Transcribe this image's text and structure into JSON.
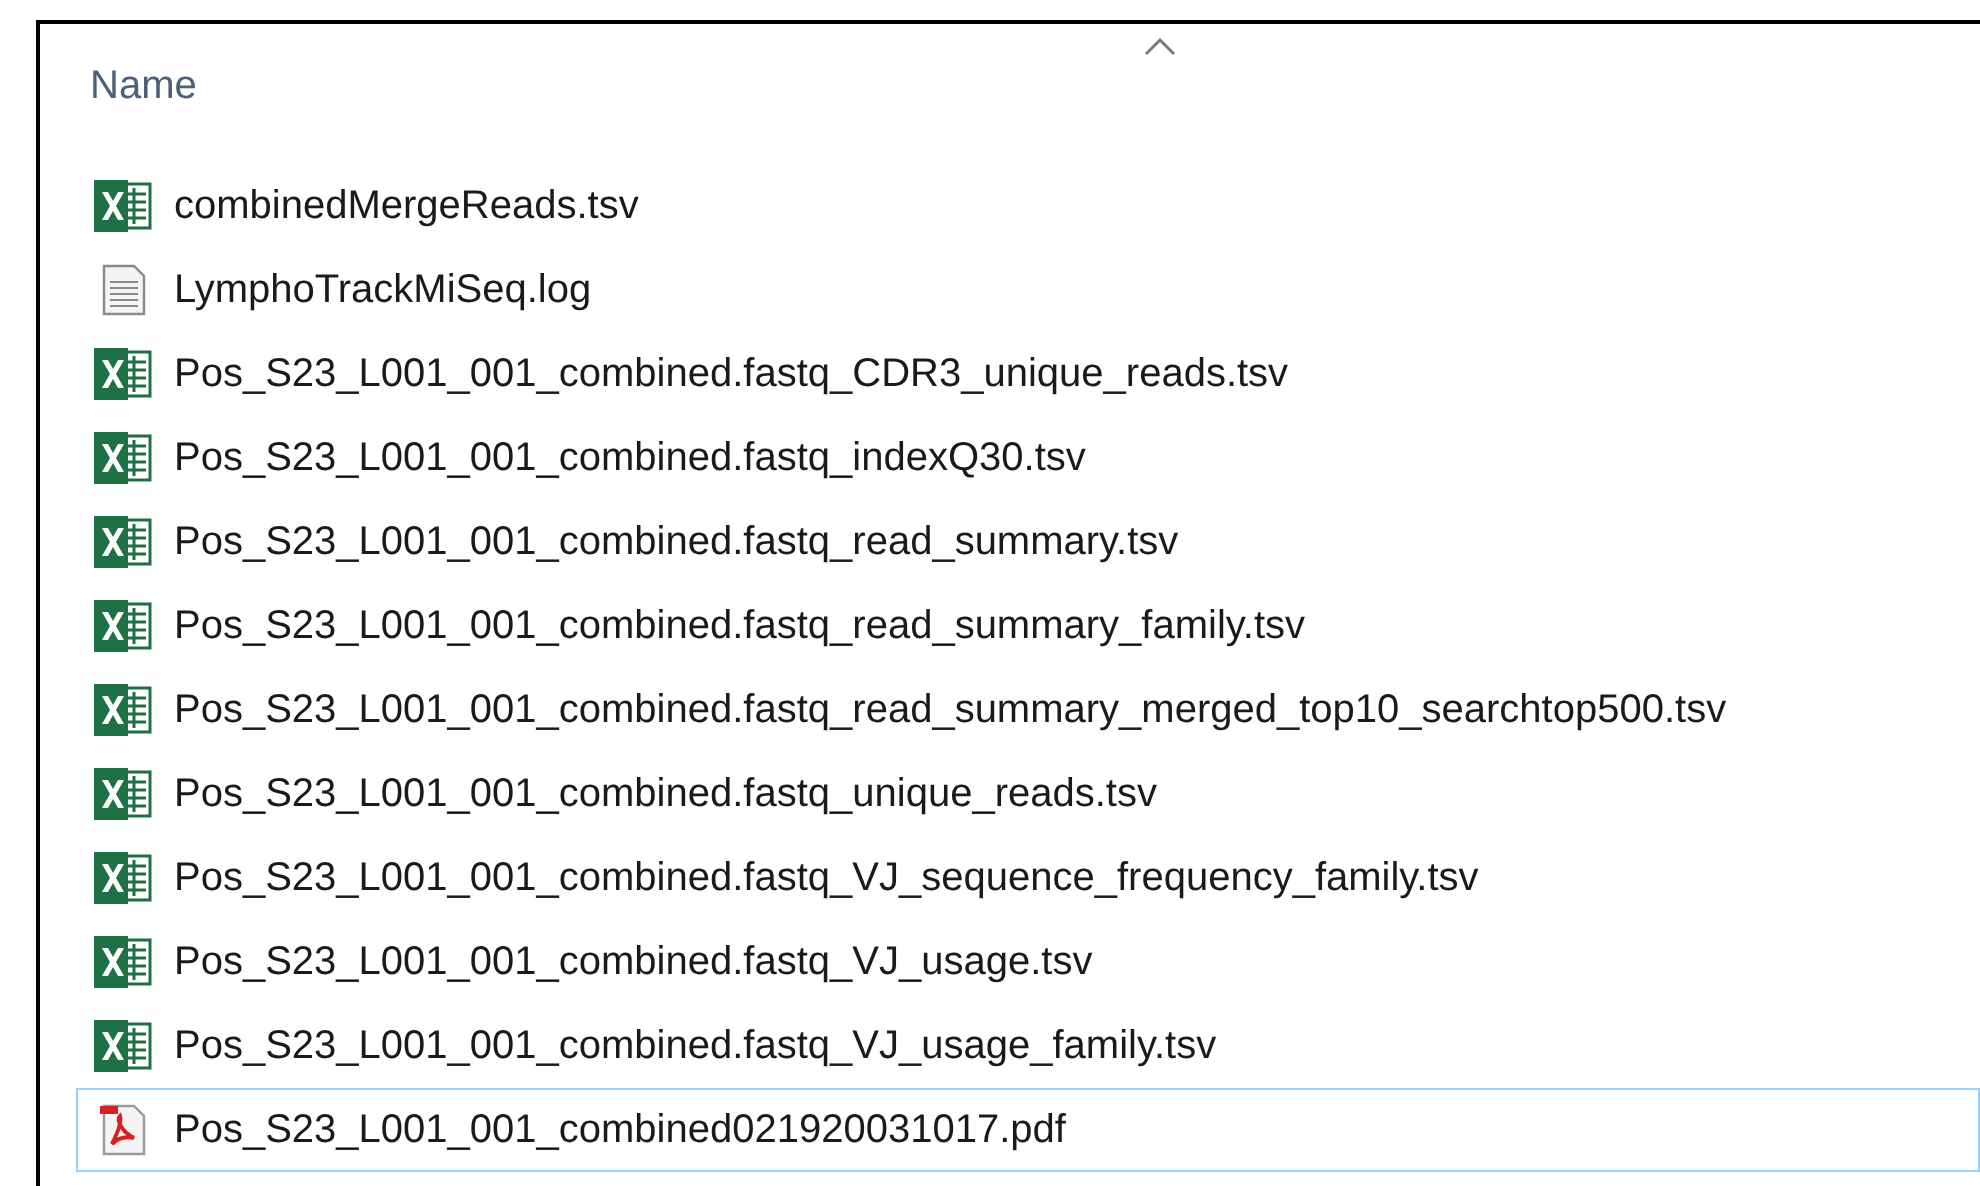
{
  "column_header": {
    "label": "Name",
    "sort_ascending": true
  },
  "files": [
    {
      "name": "combinedMergeReads.tsv",
      "kind": "excel",
      "focused": false
    },
    {
      "name": "LymphoTrackMiSeq.log",
      "kind": "text",
      "focused": false
    },
    {
      "name": "Pos_S23_L001_001_combined.fastq_CDR3_unique_reads.tsv",
      "kind": "excel",
      "focused": false
    },
    {
      "name": "Pos_S23_L001_001_combined.fastq_indexQ30.tsv",
      "kind": "excel",
      "focused": false
    },
    {
      "name": "Pos_S23_L001_001_combined.fastq_read_summary.tsv",
      "kind": "excel",
      "focused": false
    },
    {
      "name": "Pos_S23_L001_001_combined.fastq_read_summary_family.tsv",
      "kind": "excel",
      "focused": false
    },
    {
      "name": "Pos_S23_L001_001_combined.fastq_read_summary_merged_top10_searchtop500.tsv",
      "kind": "excel",
      "focused": false
    },
    {
      "name": "Pos_S23_L001_001_combined.fastq_unique_reads.tsv",
      "kind": "excel",
      "focused": false
    },
    {
      "name": "Pos_S23_L001_001_combined.fastq_VJ_sequence_frequency_family.tsv",
      "kind": "excel",
      "focused": false
    },
    {
      "name": "Pos_S23_L001_001_combined.fastq_VJ_usage.tsv",
      "kind": "excel",
      "focused": false
    },
    {
      "name": "Pos_S23_L001_001_combined.fastq_VJ_usage_family.tsv",
      "kind": "excel",
      "focused": false
    },
    {
      "name": "Pos_S23_L001_001_combined021920031017.pdf",
      "kind": "pdf",
      "focused": true
    }
  ]
}
